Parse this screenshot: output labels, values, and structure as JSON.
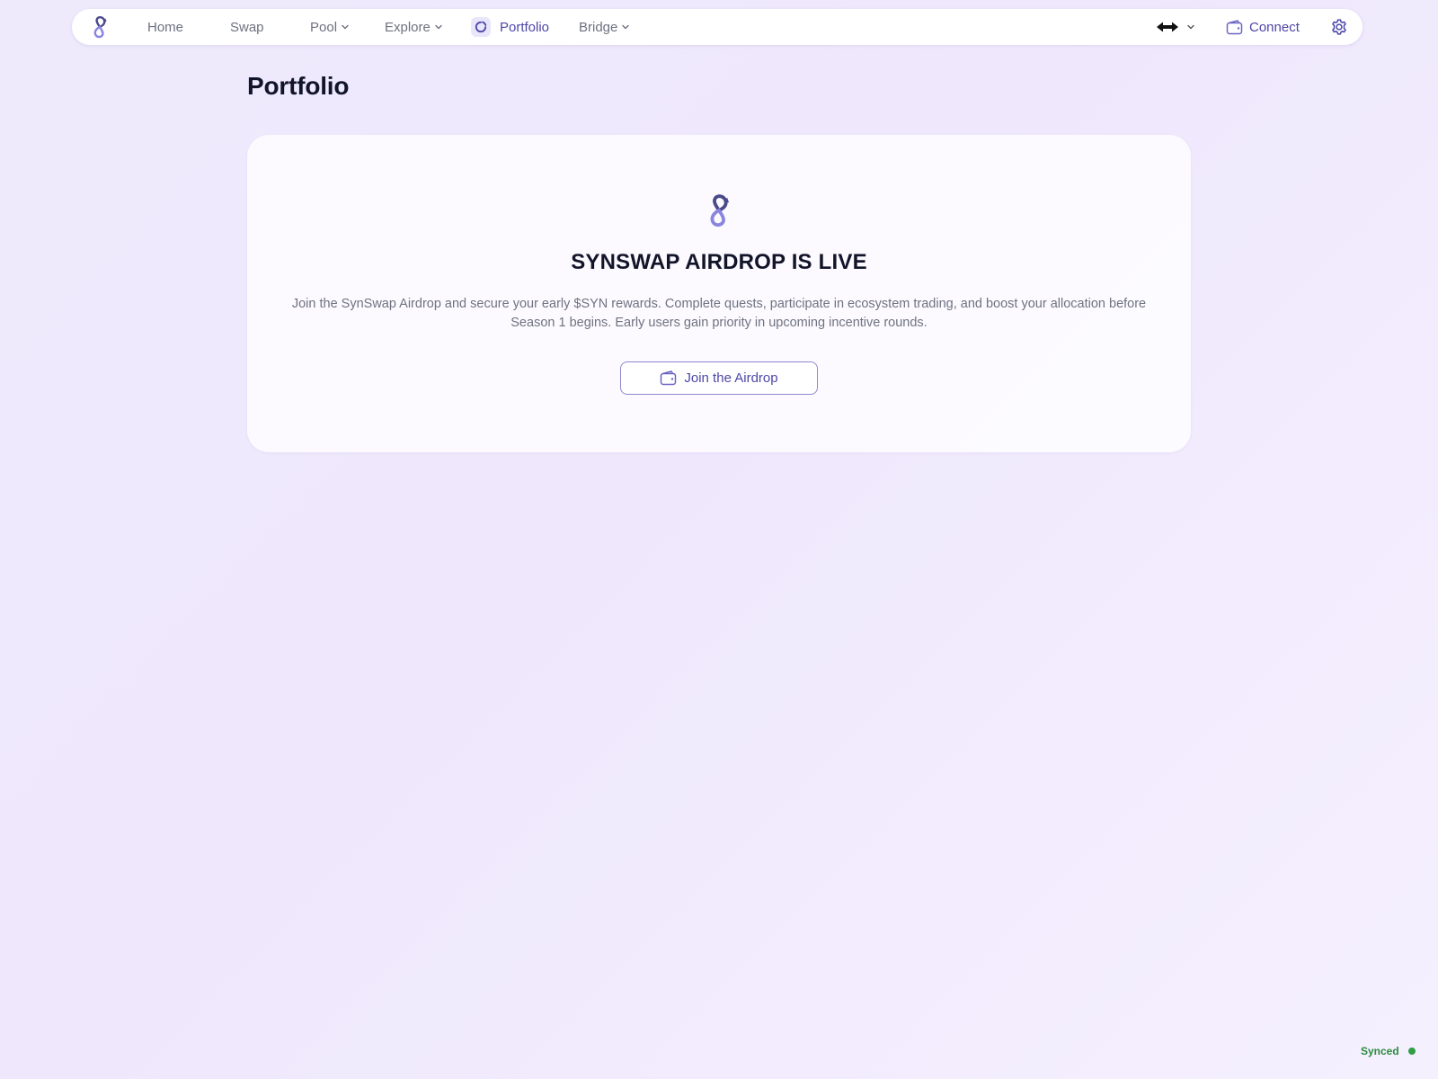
{
  "nav": {
    "items": [
      {
        "label": "Home",
        "has_dropdown": false,
        "active": false
      },
      {
        "label": "Swap",
        "has_dropdown": false,
        "active": false
      },
      {
        "label": "Pool",
        "has_dropdown": true,
        "active": false
      },
      {
        "label": "Explore",
        "has_dropdown": true,
        "active": false
      },
      {
        "label": "Portfolio",
        "has_dropdown": false,
        "active": true
      },
      {
        "label": "Bridge",
        "has_dropdown": true,
        "active": false
      }
    ],
    "connect_label": "Connect",
    "icons": {
      "logo": "synswap-logo-icon",
      "chain": "chain-arrows-icon",
      "wallet": "wallet-icon",
      "settings": "gear-icon"
    }
  },
  "page": {
    "title": "Portfolio"
  },
  "airdrop": {
    "heading": "SYNSWAP AIRDROP IS LIVE",
    "description": "Join the SynSwap Airdrop and secure your early $SYN rewards. Complete quests, participate in ecosystem trading, and boost your allocation before Season 1 begins. Early users gain priority in upcoming incentive rounds.",
    "button_label": "Join the Airdrop"
  },
  "status": {
    "label": "Synced",
    "color": "#2f9e44"
  },
  "colors": {
    "accent": "#4d47a8",
    "logo_dark": "#4a4a8a",
    "logo_light": "#8a86e0"
  }
}
